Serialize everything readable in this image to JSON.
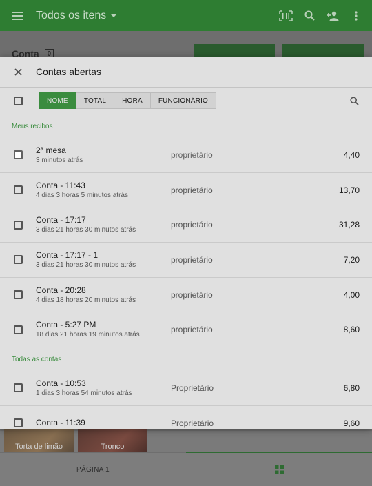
{
  "appbar": {
    "title": "Todos os itens",
    "icons": [
      "menu-icon",
      "dropdown-arrow-icon",
      "barcode-icon",
      "search-icon",
      "add-customer-icon",
      "more-vert-icon"
    ],
    "color": "#2e7d32"
  },
  "background": {
    "ticket_label": "Conta",
    "ticket_count": "0",
    "tiles": [
      {
        "label": "Torta de limão"
      },
      {
        "label": "Tronco"
      }
    ],
    "bottom": {
      "page_label": "PÁGINA 1"
    }
  },
  "dialog": {
    "title": "Contas abertas",
    "sort_options": [
      "NOME",
      "TOTAL",
      "HORA",
      "FUNCIONÁRIO"
    ],
    "active_sort": "NOME",
    "sections": [
      {
        "title": "Meus recibos",
        "rows": [
          {
            "name": "2ª mesa",
            "time": "3 minutos  atrás",
            "employee": "proprietário",
            "amount": "4,40",
            "selected": true
          },
          {
            "name": "Conta - 11:43",
            "time": "4 dias 3 horas 5 minutos  atrás",
            "employee": "proprietário",
            "amount": "13,70"
          },
          {
            "name": "Conta - 17:17",
            "time": "3 dias 21 horas 30 minutos  atrás",
            "employee": "proprietário",
            "amount": "31,28"
          },
          {
            "name": "Conta - 17:17 - 1",
            "time": "3 dias 21 horas 30 minutos  atrás",
            "employee": "proprietário",
            "amount": "7,20"
          },
          {
            "name": "Conta - 20:28",
            "time": "4 dias 18 horas 20 minutos  atrás",
            "employee": "proprietário",
            "amount": "4,00"
          },
          {
            "name": "Conta - 5:27 PM",
            "time": "18 dias 21 horas 19 minutos  atrás",
            "employee": "proprietário",
            "amount": "8,60"
          }
        ]
      },
      {
        "title": "Todas as contas",
        "rows": [
          {
            "name": "Conta - 10:53",
            "time": "1 dias 3 horas 54 minutos  atrás",
            "employee": "Proprietário",
            "amount": "6,80"
          },
          {
            "name": "Conta - 11:39",
            "time": "",
            "employee": "Proprietário",
            "amount": "9,60"
          }
        ]
      }
    ],
    "accent_color": "#43a047",
    "selection_color": "#f08a3e"
  }
}
